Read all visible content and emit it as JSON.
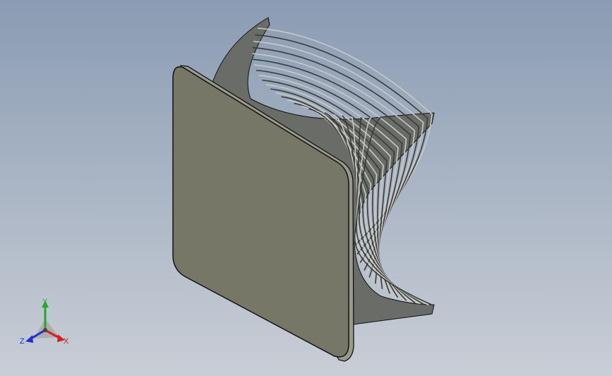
{
  "viewport": {
    "background_top": "#8a9bb3",
    "background_bottom": "#c9ced6"
  },
  "model": {
    "plate_face_color": "#767766",
    "plate_edge_color": "#9a9a8c",
    "outline_color": "#111111",
    "fin_color": "#c8cac6",
    "fin_count": 26
  },
  "triad": {
    "x_label": "X",
    "y_label": "Y",
    "z_label": "Z",
    "x_color": "#d42020",
    "y_color": "#22aa22",
    "z_color": "#2233cc"
  }
}
